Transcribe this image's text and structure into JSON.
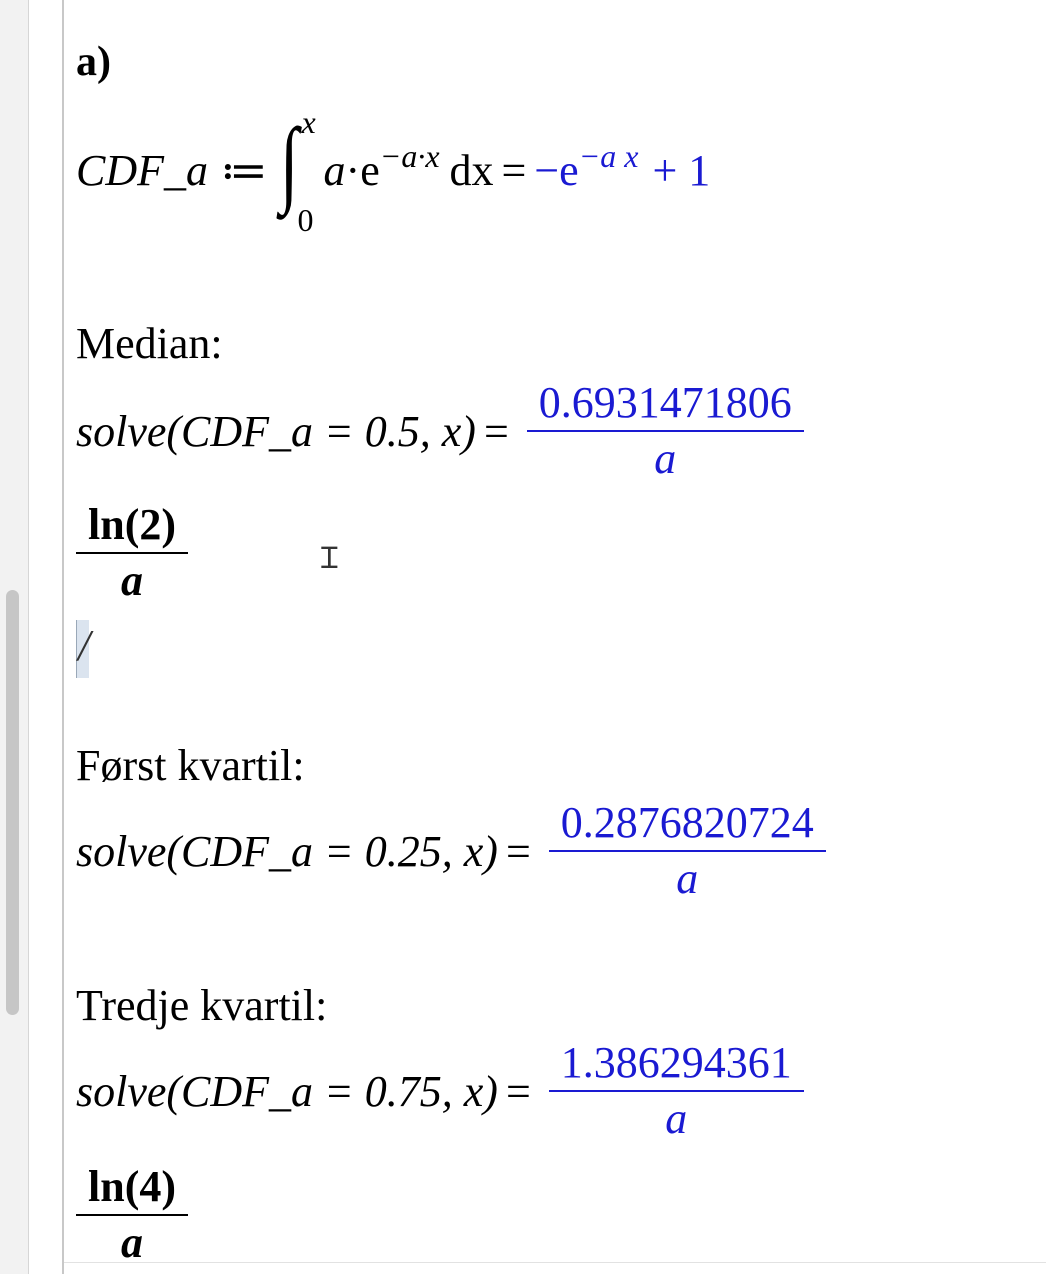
{
  "section_label": "a)",
  "cdf_definition": {
    "lhs": "CDF_a",
    "assign": "≔",
    "integral_upper": "x",
    "integral_lower": "0",
    "integrand_coef": "a",
    "dot": "·",
    "exp_base": "e",
    "integrand_exponent": "−a·x",
    "differential": "dx",
    "equals": "=",
    "result_prefix": "−e",
    "result_exponent": "−a x",
    "result_suffix": "+ 1"
  },
  "median": {
    "heading": "Median:",
    "command": "solve",
    "args": "(CDF_a = 0.5, x)",
    "equals": "=",
    "result_numerator": "0.6931471806",
    "result_denominator": "a",
    "exact_numerator": "ln(2)",
    "exact_denominator": "a"
  },
  "input_cursor": "/",
  "first_quartile": {
    "heading": "Først kvartil:",
    "command": "solve",
    "args": "(CDF_a = 0.25, x)",
    "equals": "=",
    "result_numerator": "0.2876820724",
    "result_denominator": "a"
  },
  "third_quartile": {
    "heading": "Tredje kvartil:",
    "command": "solve",
    "args": "(CDF_a = 0.75, x)",
    "equals": "=",
    "result_numerator": "1.386294361",
    "result_denominator": "a",
    "exact_numerator": "ln(4)",
    "exact_denominator": "a"
  },
  "colors": {
    "output_blue": "#1a1ad2",
    "text": "#000000"
  },
  "icons": {
    "text_cursor": "i-beam-cursor-icon"
  }
}
